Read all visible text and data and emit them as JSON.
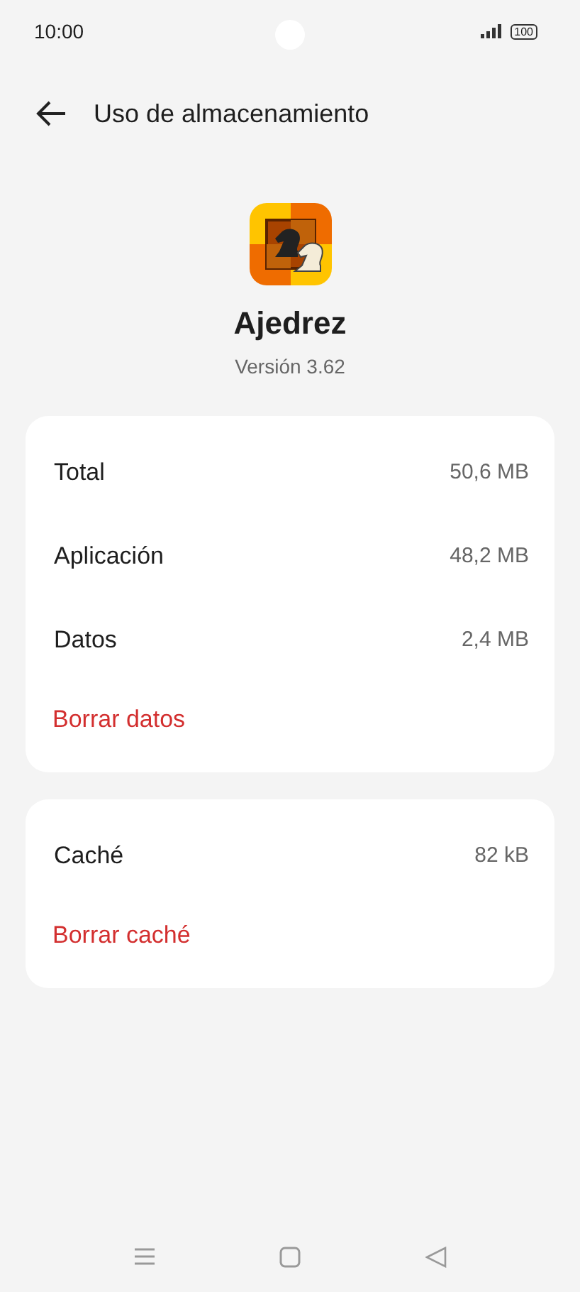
{
  "status_bar": {
    "time": "10:00",
    "battery": "100"
  },
  "header": {
    "title": "Uso de almacenamiento"
  },
  "app": {
    "name": "Ajedrez",
    "version": "Versión 3.62"
  },
  "cards": [
    {
      "rows": [
        {
          "label": "Total",
          "value": "50,6 MB"
        },
        {
          "label": "Aplicación",
          "value": "48,2 MB"
        },
        {
          "label": "Datos",
          "value": "2,4 MB"
        }
      ],
      "action": "Borrar datos"
    },
    {
      "rows": [
        {
          "label": "Caché",
          "value": "82 kB"
        }
      ],
      "action": "Borrar caché"
    }
  ]
}
